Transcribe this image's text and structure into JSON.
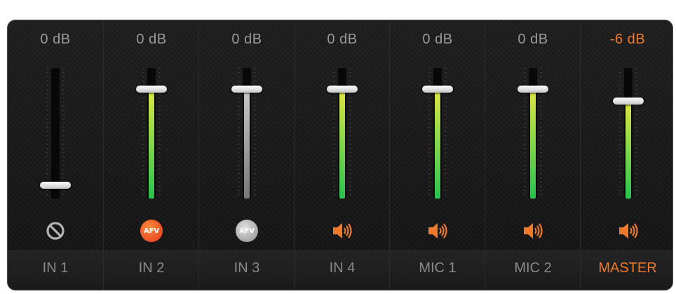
{
  "mixer": {
    "channels": [
      {
        "name": "IN 1",
        "db": "0 dB",
        "icon": "mute-icon",
        "fader_level": 0.1,
        "meter_level": 0,
        "meter_color": "none",
        "master": false
      },
      {
        "name": "IN 2",
        "db": "0 dB",
        "icon": "afv-on-icon",
        "afv_label": "AFV",
        "fader_level": 0.84,
        "meter_level": 0.84,
        "meter_color": "green",
        "master": false
      },
      {
        "name": "IN 3",
        "db": "0 dB",
        "icon": "afv-off-icon",
        "afv_label": "AFV",
        "fader_level": 0.84,
        "meter_level": 0.84,
        "meter_color": "gray",
        "master": false
      },
      {
        "name": "IN 4",
        "db": "0 dB",
        "icon": "speaker-icon",
        "fader_level": 0.84,
        "meter_level": 0.84,
        "meter_color": "green",
        "master": false
      },
      {
        "name": "MIC 1",
        "db": "0 dB",
        "icon": "speaker-icon",
        "fader_level": 0.84,
        "meter_level": 0.84,
        "meter_color": "green",
        "master": false
      },
      {
        "name": "MIC 2",
        "db": "0 dB",
        "icon": "speaker-icon",
        "fader_level": 0.84,
        "meter_level": 0.84,
        "meter_color": "green",
        "master": false
      },
      {
        "name": "MASTER",
        "db": "-6 dB",
        "icon": "speaker-icon",
        "fader_level": 0.75,
        "meter_level": 0.75,
        "meter_color": "green",
        "master": true
      }
    ]
  },
  "colors": {
    "accent": "#ef7a2c",
    "text": "#9a9a9a",
    "meter_green": "#29c24f",
    "meter_yellow": "#e2e642"
  }
}
